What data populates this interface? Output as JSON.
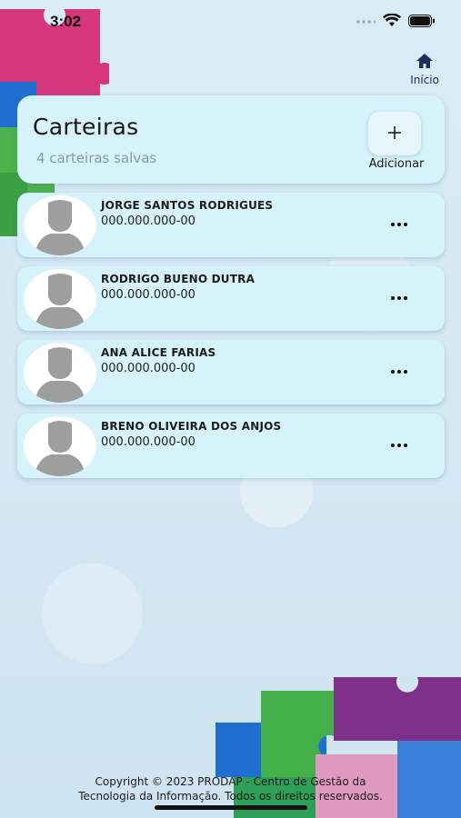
{
  "status_bar": {
    "time": "3:02",
    "icons": [
      "signal-icon",
      "wifi-icon",
      "battery-icon"
    ]
  },
  "nav": {
    "home_label": "Início",
    "home_icon": "home-icon"
  },
  "header": {
    "title": "Carteiras",
    "subtitle": "4 carteiras salvas",
    "add_label": "Adicionar",
    "add_symbol": "+"
  },
  "wallets": [
    {
      "name": "JORGE SANTOS RODRIGUES",
      "cpf": "000.000.000-00"
    },
    {
      "name": "RODRIGO BUENO DUTRA",
      "cpf": "000.000.000-00"
    },
    {
      "name": "ANA ALICE FARIAS",
      "cpf": "000.000.000-00"
    },
    {
      "name": "BRENO OLIVEIRA DOS ANJOS",
      "cpf": "000.000.000-00"
    }
  ],
  "footer": {
    "line1": "Copyright © 2023  PRODAP - Centro de Gestão da",
    "line2": "Tecnologia da Informação. Todos os direitos reservados."
  },
  "colors": {
    "card_bg": "#d6f2fb",
    "nav_accent": "#1d2c5a",
    "avatar_gray": "#9e9e9e"
  }
}
